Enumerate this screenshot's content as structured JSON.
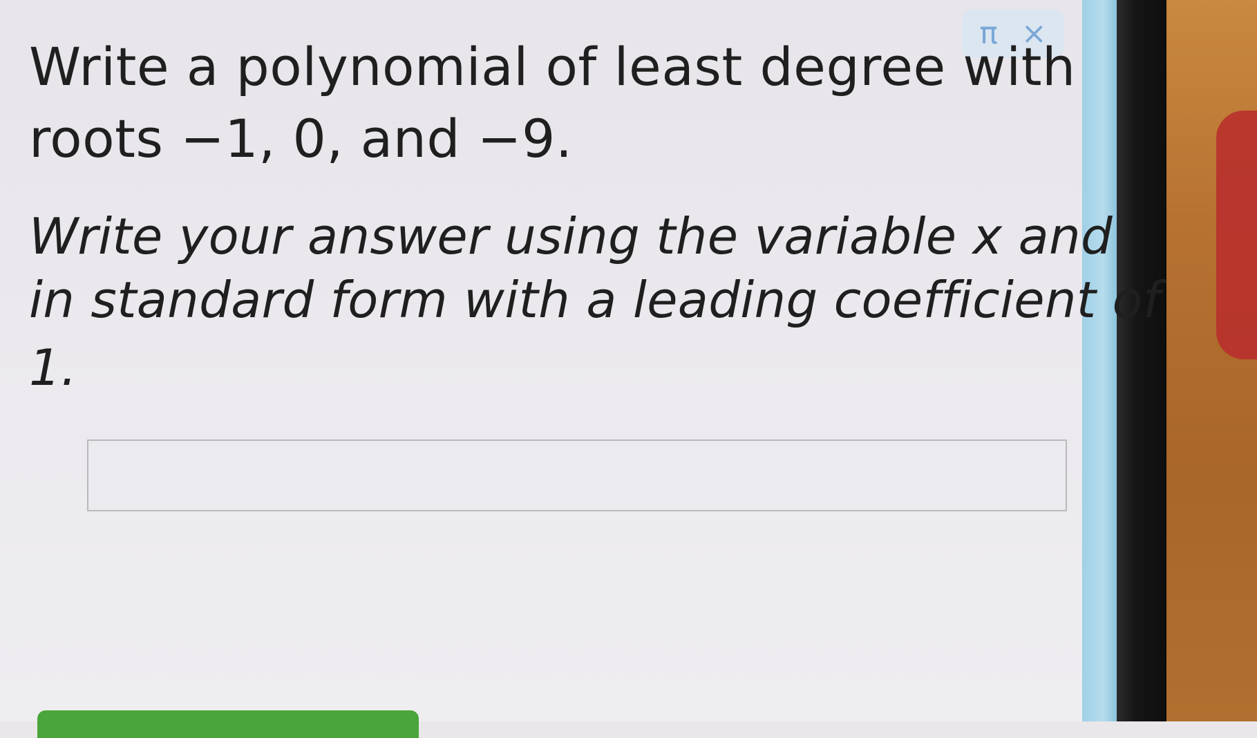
{
  "toolbar": {
    "pi_symbol": "π",
    "close_symbol": "×"
  },
  "question": {
    "line1": "Write a polynomial of least degree with",
    "line2": "roots −1, 0, and −9."
  },
  "instructions": {
    "line1": "Write your answer using the variable x and",
    "line2": "in standard form with a leading coefficient of",
    "line3": "1."
  },
  "answer": {
    "value": "",
    "placeholder": ""
  },
  "colors": {
    "accent": "#7aa7d6",
    "button": "#4aa53a"
  }
}
